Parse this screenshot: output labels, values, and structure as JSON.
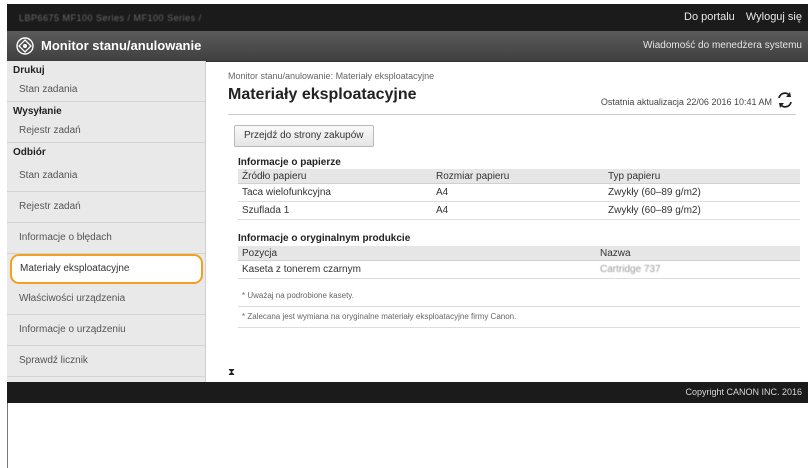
{
  "window": {
    "title_blur": "LBP6675  MF100 Series / MF100 Series /"
  },
  "topbar": {
    "portal_link": "Do portalu",
    "logout_link": "Wyloguj się"
  },
  "header": {
    "title": "Monitor stanu/anulowanie",
    "message_link": "Wiadomość do menedżera systemu"
  },
  "sidebar": {
    "groups": [
      {
        "label": "Drukuj",
        "items": [
          "Stan zadania"
        ]
      },
      {
        "label": "Wysyłanie",
        "items": [
          "Rejestr zadań"
        ]
      },
      {
        "label": "Odbiór",
        "items": [
          "Stan zadania",
          "Rejestr zadań"
        ]
      }
    ],
    "items": [
      "Informacje o błędach",
      "Materiały eksploatacyjne",
      "Właściwości urządzenia",
      "Informacje o urządzeniu",
      "Sprawdź licznik"
    ],
    "selected": "Materiały eksploatacyjne"
  },
  "main": {
    "breadcrumb": "Monitor stanu/anulowanie: Materiały eksploatacyjne",
    "title": "Materiały eksploatacyjne",
    "last_update": "Ostatnia aktualizacja 22/06 2016 10:41 AM",
    "purchase_button": "Przejdź do strony zakupów",
    "paper_section": "Informacje o papierze",
    "paper_columns": [
      "Źródło papieru",
      "Rozmiar papieru",
      "Typ papieru"
    ],
    "paper_rows": [
      [
        "Taca wielofunkcyjna",
        "A4",
        "Zwykły (60–89 g/m2)"
      ],
      [
        "Szuflada 1",
        "A4",
        "Zwykły (60–89 g/m2)"
      ]
    ],
    "original_section": "Informacje o oryginalnym produkcie",
    "original_columns": [
      "Pozycja",
      "Nazwa"
    ],
    "original_rows": [
      [
        "Kaseta z tonerem czarnym",
        "Cartridge 737"
      ]
    ],
    "note1": "* Uważaj na podrobione kasety.",
    "note2": "* Zalecana jest wymiana na oryginalne materiały eksploatacyjne firmy Canon."
  },
  "footer": {
    "copyright": "Copyright CANON INC. 2016"
  },
  "colors": {
    "selection_outline": "#f3a020",
    "topbar_bg": "#1b1b1b",
    "header_bg": "#4a4a4a"
  }
}
